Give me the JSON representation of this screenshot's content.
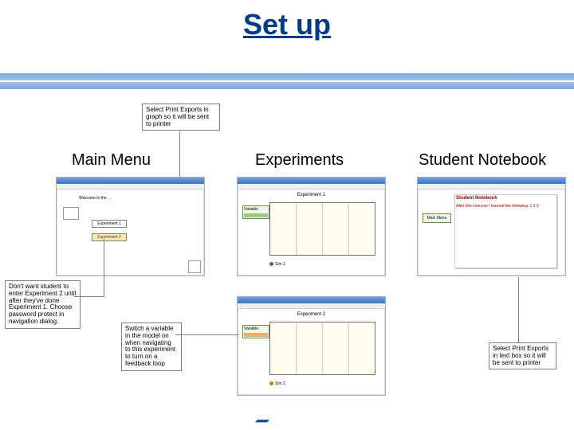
{
  "title": "Set up",
  "columns": [
    "Main Menu",
    "Experiments",
    "Student Notebook"
  ],
  "notes": {
    "top": "Select Print Exports in graph so it will be sent to printer",
    "left": "Don't want student to enter Experiment 2 until after they've done Experiment 1. Choose password protect in navigation dialog.",
    "mid": "Switch a variable in the model on when navigating to this experiment to turn on a feedback loop",
    "right": "Select Print Exports in text box so it will be sent to printer"
  },
  "thumbs": {
    "main": {
      "heading": "Welcome to the ...",
      "btn1": "Experiment 1",
      "btn2": "Experiment 2"
    },
    "exp1": {
      "title": "Experiment 1",
      "var": "Variable",
      "series": "Sim 1"
    },
    "exp2": {
      "title": "Experiment 2",
      "var": "Variable",
      "series": "Sim 1"
    },
    "notebook": {
      "title": "Student Notebook",
      "sub": "After this exercise I learned the following:\n1\n2\n3",
      "btn": "Main Menu"
    }
  },
  "footer": ""
}
